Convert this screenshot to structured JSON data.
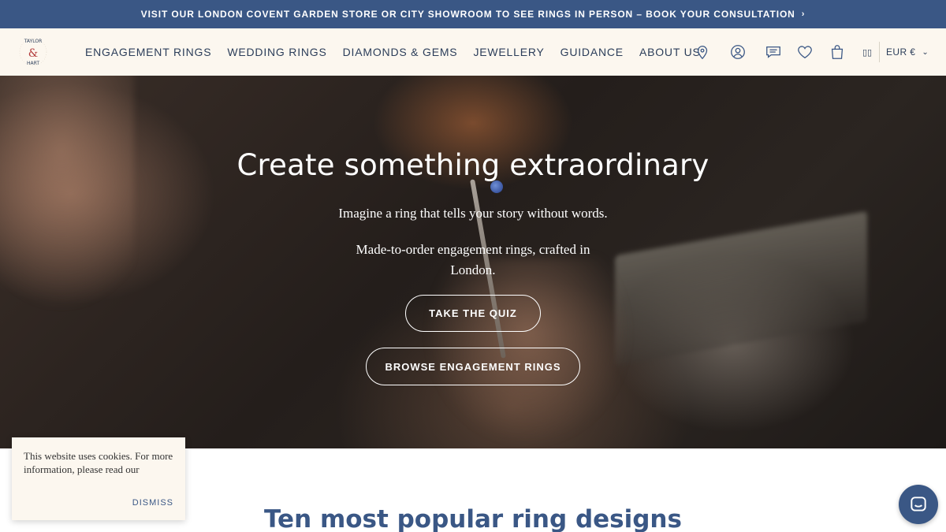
{
  "announcement": {
    "text": "VISIT OUR LONDON COVENT GARDEN STORE OR CITY SHOWROOM TO SEE RINGS IN PERSON – BOOK YOUR CONSULTATION",
    "chevron": "›"
  },
  "header": {
    "logo_text": "TAYLOR & HART",
    "nav": [
      {
        "label": "ENGAGEMENT RINGS"
      },
      {
        "label": "WEDDING RINGS"
      },
      {
        "label": "DIAMONDS & GEMS"
      },
      {
        "label": "JEWELLERY"
      },
      {
        "label": "GUIDANCE"
      },
      {
        "label": "ABOUT US"
      }
    ],
    "icons": [
      "location-icon",
      "account-icon",
      "chat-icon",
      "heart-icon",
      "bag-icon"
    ],
    "flag": "▯▯",
    "currency": "EUR €",
    "currency_caret": "⌄"
  },
  "hero": {
    "title": "Create something extraordinary",
    "subtitle1": "Imagine a ring that tells your story without words.",
    "subtitle2": "Made-to-order engagement rings, crafted in London.",
    "quiz_button": "TAKE THE QUIZ",
    "browse_button": "BROWSE ENGAGEMENT RINGS"
  },
  "section": {
    "title": "Ten most popular ring designs"
  },
  "cookie": {
    "text": "This website uses cookies. For more information, please read our",
    "dismiss": "DISMISS"
  },
  "colors": {
    "brand_blue": "#3a5785",
    "cream": "#fcf7ef",
    "nav_text": "#2c3e5a"
  }
}
